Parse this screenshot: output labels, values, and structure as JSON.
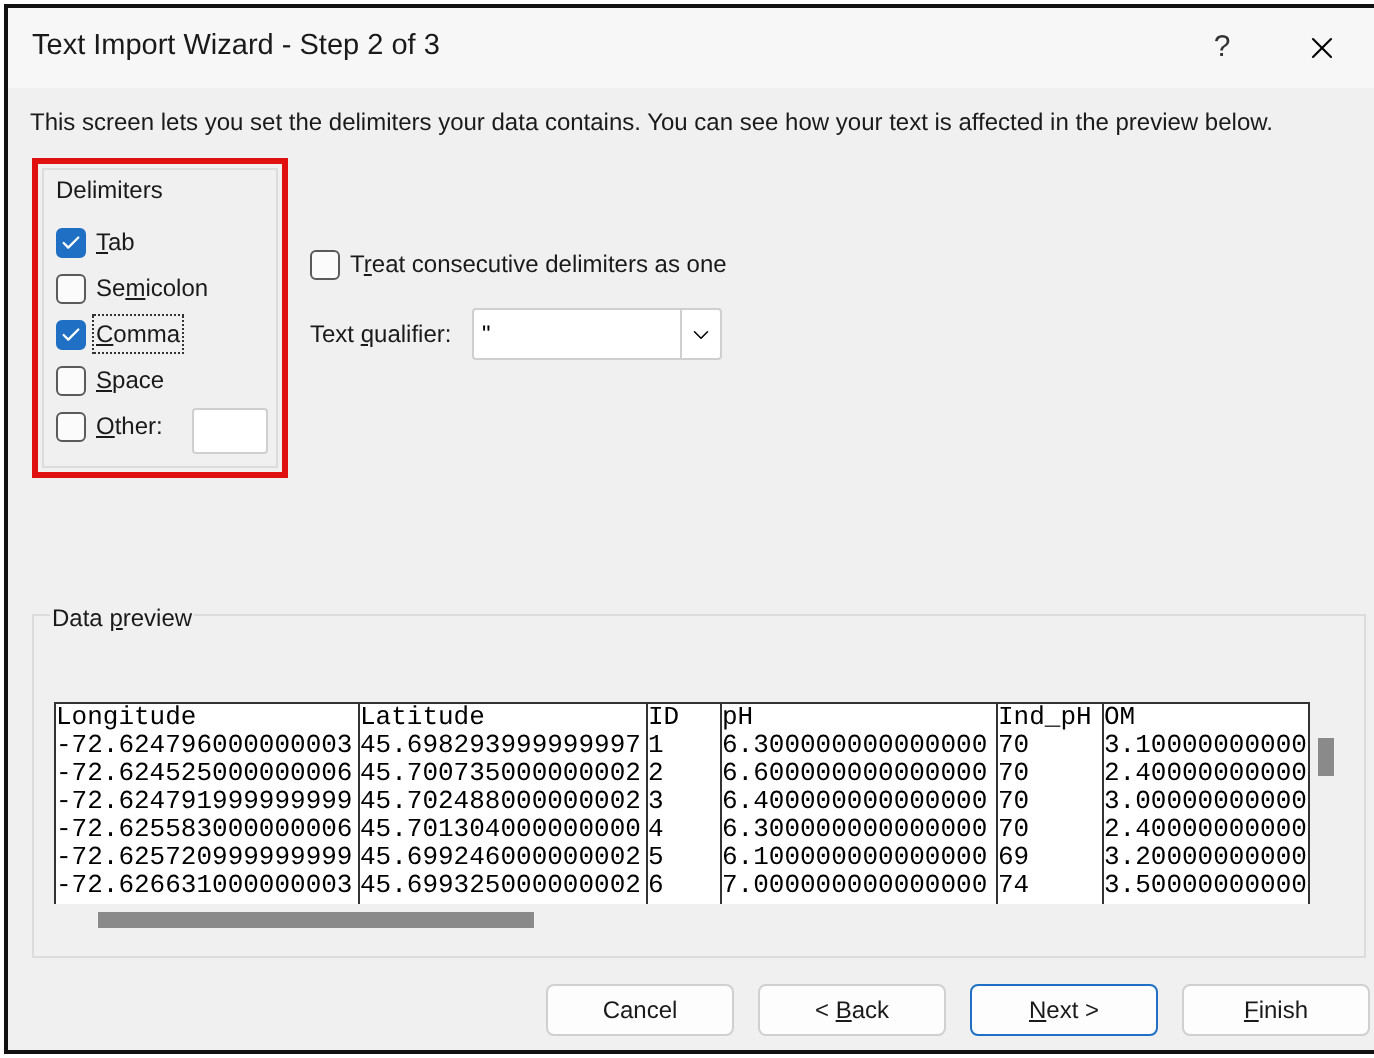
{
  "window": {
    "title": "Text Import Wizard - Step 2 of 3",
    "help": "?"
  },
  "intro": "This screen lets you set the delimiters your data contains.  You can see how your text is affected in the preview below.",
  "delimiters": {
    "title": "Delimiters",
    "highlighted": true,
    "items": [
      {
        "kind": "checkbox",
        "key": "T",
        "after": "ab",
        "checked": true,
        "focused": false
      },
      {
        "kind": "checkbox",
        "before": "Se",
        "key": "m",
        "after": "icolon",
        "checked": false,
        "focused": false
      },
      {
        "kind": "checkbox",
        "key": "C",
        "after": "omma",
        "checked": true,
        "focused": true
      },
      {
        "kind": "checkbox",
        "key": "S",
        "after": "pace",
        "checked": false,
        "focused": false
      },
      {
        "kind": "other",
        "key": "O",
        "after": "ther:",
        "checked": false,
        "focused": false
      }
    ]
  },
  "consecutive": {
    "before": "T",
    "key": "r",
    "after": "eat consecutive delimiters as one",
    "checked": false
  },
  "qualifier": {
    "before": "Text ",
    "key": "q",
    "after": "ualifier:",
    "value": "\""
  },
  "preview": {
    "before": "Data ",
    "key": "p",
    "after": "review",
    "columns": [
      "Longitude",
      "Latitude",
      "ID",
      "pH",
      "Ind_pH",
      "OM"
    ],
    "rows": [
      [
        "-72.624796000000003",
        "45.698293999999997",
        "1",
        "6.300000000000000",
        "70",
        "3.10000000000"
      ],
      [
        "-72.624525000000006",
        "45.700735000000002",
        "2",
        "6.600000000000000",
        "70",
        "2.40000000000"
      ],
      [
        "-72.624791999999999",
        "45.702488000000002",
        "3",
        "6.400000000000000",
        "70",
        "3.00000000000"
      ],
      [
        "-72.625583000000006",
        "45.701304000000000",
        "4",
        "6.300000000000000",
        "70",
        "2.40000000000"
      ],
      [
        "-72.625720999999999",
        "45.699246000000002",
        "5",
        "6.100000000000000",
        "69",
        "3.20000000000"
      ],
      [
        "-72.626631000000003",
        "45.699325000000002",
        "6",
        "7.000000000000000",
        "74",
        "3.50000000000"
      ]
    ]
  },
  "buttons": [
    {
      "before": "Cancel",
      "default": false
    },
    {
      "before": "< ",
      "key": "B",
      "after": "ack",
      "default": false
    },
    {
      "key": "N",
      "after": "ext >",
      "default": true
    },
    {
      "key": "F",
      "after": "inish",
      "default": false
    }
  ]
}
